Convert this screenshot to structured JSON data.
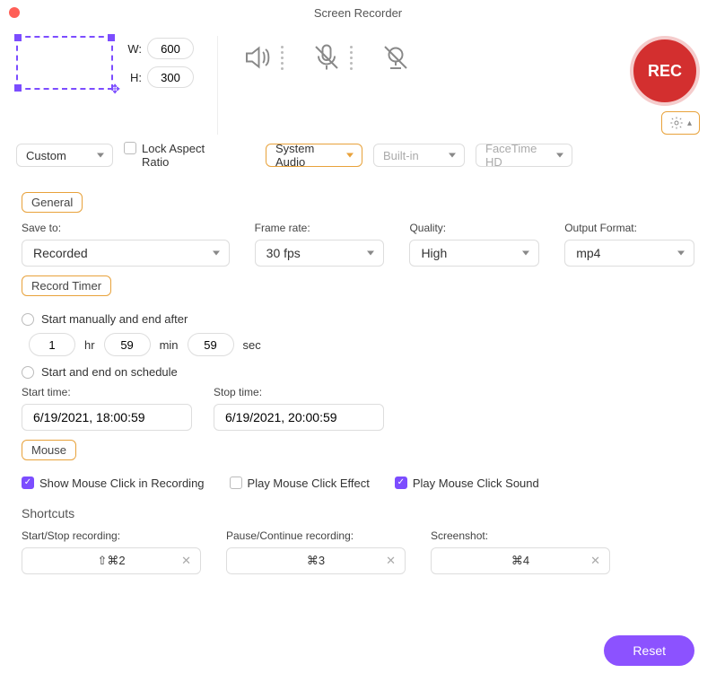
{
  "window": {
    "title": "Screen Recorder"
  },
  "region": {
    "width_label": "W:",
    "height_label": "H:",
    "width": "600",
    "height": "300",
    "preset": "Custom",
    "lock_aspect_label": "Lock Aspect Ratio",
    "lock_aspect_checked": false
  },
  "audio": {
    "system_select": "System Audio",
    "mic_select": "Built-in",
    "camera_select": "FaceTime HD"
  },
  "rec_label": "REC",
  "settings_icon": "settings",
  "sections": {
    "general": {
      "tag": "General",
      "save_to_label": "Save to:",
      "save_to_value": "Recorded",
      "frame_rate_label": "Frame rate:",
      "frame_rate_value": "30 fps",
      "quality_label": "Quality:",
      "quality_value": "High",
      "format_label": "Output Format:",
      "format_value": "mp4"
    },
    "timer": {
      "tag": "Record Timer",
      "manual_label": "Start manually and end after",
      "hr_value": "1",
      "hr_unit": "hr",
      "min_value": "59",
      "min_unit": "min",
      "sec_value": "59",
      "sec_unit": "sec",
      "schedule_label": "Start and end on schedule",
      "start_time_label": "Start time:",
      "start_time_value": "6/19/2021, 18:00:59",
      "stop_time_label": "Stop time:",
      "stop_time_value": "6/19/2021, 20:00:59"
    },
    "mouse": {
      "tag": "Mouse",
      "show_click_label": "Show Mouse Click in Recording",
      "show_click_checked": true,
      "play_effect_label": "Play Mouse Click Effect",
      "play_effect_checked": false,
      "play_sound_label": "Play Mouse Click Sound",
      "play_sound_checked": true
    },
    "shortcuts": {
      "title": "Shortcuts",
      "start_stop_label": "Start/Stop recording:",
      "start_stop_value": "⇧⌘2",
      "pause_label": "Pause/Continue recording:",
      "pause_value": "⌘3",
      "screenshot_label": "Screenshot:",
      "screenshot_value": "⌘4"
    }
  },
  "footer": {
    "reset_label": "Reset"
  }
}
